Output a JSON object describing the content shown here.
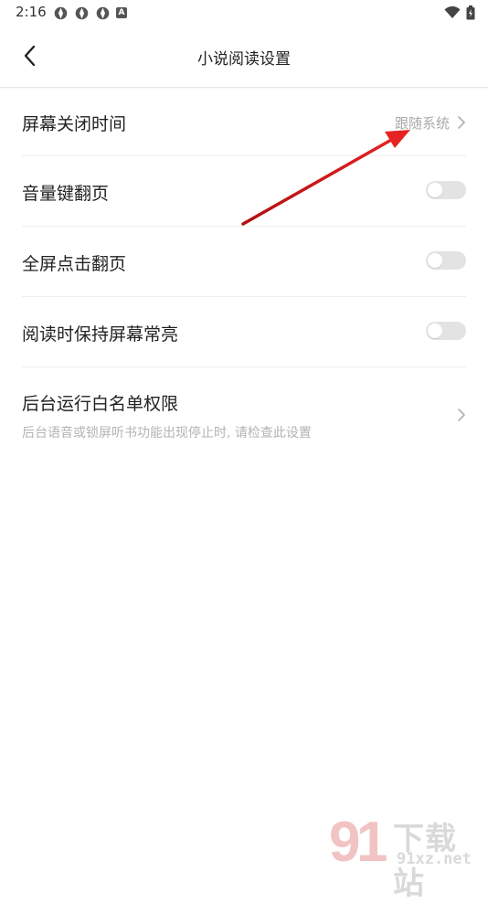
{
  "status": {
    "time": "2:16",
    "small_icon_text": "A"
  },
  "header": {
    "title": "小说阅读设置",
    "back_icon": "chevron-left-icon"
  },
  "settings": [
    {
      "label": "屏幕关闭时间",
      "value": "跟随系统",
      "type": "link"
    },
    {
      "label": "音量键翻页",
      "type": "toggle",
      "enabled": false
    },
    {
      "label": "全屏点击翻页",
      "type": "toggle",
      "enabled": false
    },
    {
      "label": "阅读时保持屏幕常亮",
      "type": "toggle",
      "enabled": false
    },
    {
      "label": "后台运行白名单权限",
      "sublabel": "后台语音或锁屏听书功能出现停止时, 请检查此设置",
      "type": "link"
    }
  ],
  "watermark": {
    "text_big": "下载站",
    "text_small": "91xz.net"
  },
  "colors": {
    "annotation_arrow": "#d91e1e",
    "toggle_off": "#e3e3e3",
    "secondary_text": "#aaaaaa"
  }
}
